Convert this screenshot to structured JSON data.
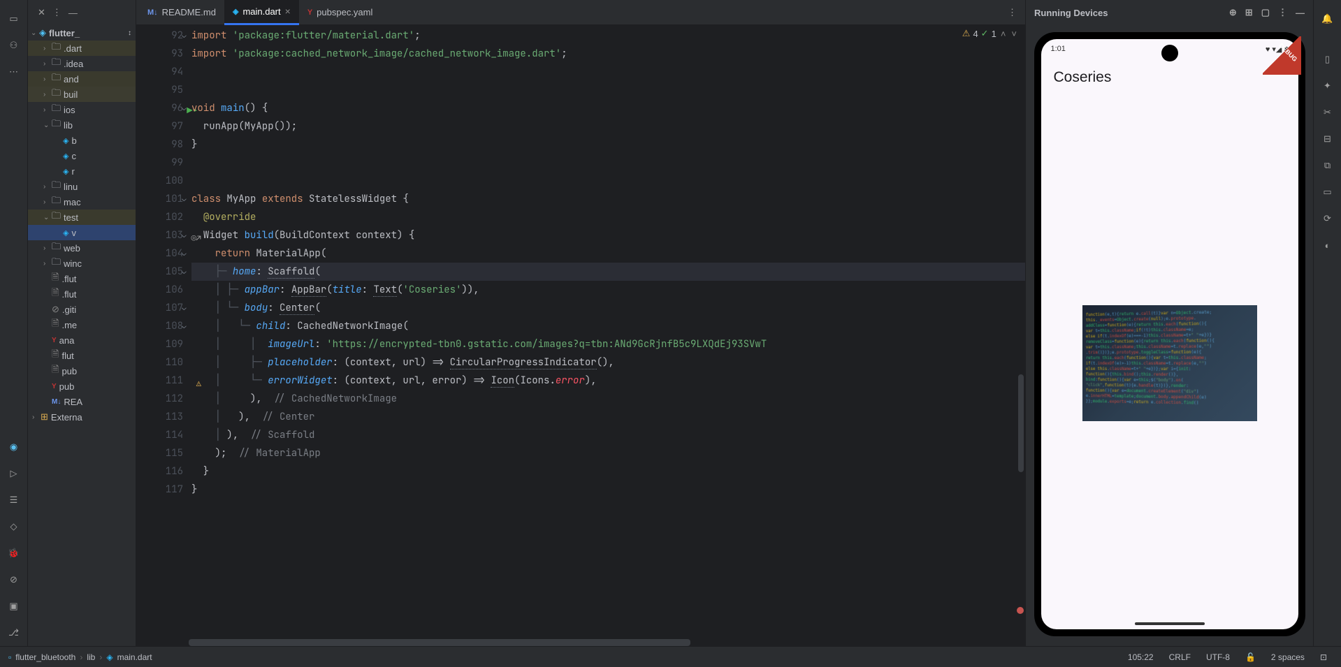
{
  "tabs": [
    {
      "icon": "M↓",
      "iconColor": "#6c95eb",
      "label": "README.md",
      "active": false
    },
    {
      "icon": "◈",
      "iconColor": "#29b6f6",
      "label": "main.dart",
      "active": true,
      "closeable": true
    },
    {
      "icon": "Y",
      "iconColor": "#c23434",
      "label": "pubspec.yaml",
      "active": false
    }
  ],
  "project": {
    "root": "flutter_",
    "items": [
      {
        "indent": 1,
        "chev": "›",
        "folder": true,
        "label": ".dart",
        "hl": true
      },
      {
        "indent": 1,
        "chev": "›",
        "folder": true,
        "label": ".idea"
      },
      {
        "indent": 1,
        "chev": "›",
        "folder": true,
        "label": "and",
        "hl": true
      },
      {
        "indent": 1,
        "chev": "›",
        "folder": true,
        "label": "buil",
        "hl2": true
      },
      {
        "indent": 1,
        "chev": "›",
        "folder": true,
        "label": "ios"
      },
      {
        "indent": 1,
        "chev": "⌄",
        "folder": true,
        "label": "lib"
      },
      {
        "indent": 2,
        "dart": true,
        "label": "b"
      },
      {
        "indent": 2,
        "dart": true,
        "label": "c"
      },
      {
        "indent": 2,
        "dart": true,
        "label": "r"
      },
      {
        "indent": 1,
        "chev": "›",
        "folder": true,
        "label": "linu"
      },
      {
        "indent": 1,
        "chev": "›",
        "folder": true,
        "label": "mac"
      },
      {
        "indent": 1,
        "chev": "⌄",
        "folder": true,
        "label": "test",
        "hl": true
      },
      {
        "indent": 2,
        "dart": true,
        "label": "v",
        "selected": true
      },
      {
        "indent": 1,
        "chev": "›",
        "folder": true,
        "label": "web"
      },
      {
        "indent": 1,
        "chev": "›",
        "folder": true,
        "label": "winc"
      },
      {
        "indent": 1,
        "file": true,
        "label": ".flut"
      },
      {
        "indent": 1,
        "file": true,
        "label": ".flut"
      },
      {
        "indent": 1,
        "file": true,
        "label": ".giti",
        "gitignore": true
      },
      {
        "indent": 1,
        "file": true,
        "label": ".me"
      },
      {
        "indent": 1,
        "yaml": true,
        "label": "ana"
      },
      {
        "indent": 1,
        "file": true,
        "label": "flut"
      },
      {
        "indent": 1,
        "file": true,
        "label": "pub"
      },
      {
        "indent": 1,
        "yaml": true,
        "label": "pub"
      },
      {
        "indent": 1,
        "md": true,
        "label": "REA"
      },
      {
        "indent": 0,
        "chev": "›",
        "lib": true,
        "label": "Externa"
      }
    ]
  },
  "inspections": {
    "warnings": "4",
    "checks": "1"
  },
  "code": {
    "lines": [
      {
        "n": "92",
        "fold": "⌄",
        "html": "<span class='kw'>import</span> <span class='str'>'package:flutter/material.dart'</span>;"
      },
      {
        "n": "93",
        "html": "<span class='kw'>import</span> <span class='str'>'package:cached_network_image/cached_network_image.dart'</span>;"
      },
      {
        "n": "94",
        "html": ""
      },
      {
        "n": "95",
        "html": ""
      },
      {
        "n": "96",
        "run": true,
        "fold": "⌄",
        "html": "<span class='kw'>void</span> <span class='func'>main</span>() {"
      },
      {
        "n": "97",
        "html": "  runApp(MyApp());"
      },
      {
        "n": "98",
        "html": "}"
      },
      {
        "n": "99",
        "html": ""
      },
      {
        "n": "100",
        "html": ""
      },
      {
        "n": "101",
        "fold": "⌄",
        "html": "<span class='kw'>class</span> <span class='type'>MyApp</span> <span class='kw'>extends</span> <span class='type'>StatelessWidget</span> {"
      },
      {
        "n": "102",
        "html": "  <span class='meta'>@override</span>"
      },
      {
        "n": "103",
        "target": true,
        "fold": "⌄",
        "html": "  <span class='type'>Widget</span> <span class='func'>build</span>(<span class='type'>BuildContext</span> context) {"
      },
      {
        "n": "104",
        "fold": "⌄",
        "html": "    <span class='kw'>return</span> MaterialApp("
      },
      {
        "n": "105",
        "fold": "⌄",
        "cursor": true,
        "html": "    <span class='guide'>├─</span> <span class='param'>home</span>: <span class='info'>Scaffold</span>("
      },
      {
        "n": "106",
        "html": "    <span class='guide'>│ ├─</span> <span class='param'>appBar</span>: <span class='info'>AppBar</span>(<span class='param'>title</span>: <span class='info'>Text</span>(<span class='str'>'Coseries'</span>)),"
      },
      {
        "n": "107",
        "fold": "⌄",
        "html": "    <span class='guide'>│ └─</span> <span class='param'>body</span>: <span class='info'>Center</span>("
      },
      {
        "n": "108",
        "fold": "⌄",
        "html": "    <span class='guide'>│   └─</span> <span class='param'>child</span>: CachedNetworkImage("
      },
      {
        "n": "109",
        "html": "    <span class='guide'>│     │ </span> <span class='param'>imageUrl</span>: <span class='str'>'https://encrypted-tbn0.gstatic.com/images?q=tbn:ANd9GcRjnfB5c9LXQdEj93SVwT</span>"
      },
      {
        "n": "110",
        "html": "    <span class='guide'>│     ├─</span> <span class='param'>placeholder</span>: (context, url) => <span class='info'>CircularProgressIndicator</span>(),"
      },
      {
        "n": "111",
        "warn": true,
        "html": "    <span class='guide'>│     └─</span> <span class='param'>errorWidget</span>: (context, url, error) => <span class='info'>Icon</span>(Icons.<span class='error-field'>error</span>),"
      },
      {
        "n": "112",
        "html": "    <span class='guide'>│     </span>),  <span class='comment'>// CachedNetworkImage</span>"
      },
      {
        "n": "113",
        "html": "    <span class='guide'>│   </span>),  <span class='comment'>// Center</span>"
      },
      {
        "n": "114",
        "html": "    <span class='guide'>│ </span>),  <span class='comment'>// Scaffold</span>"
      },
      {
        "n": "115",
        "html": "    );  <span class='comment'>// MaterialApp</span>"
      },
      {
        "n": "116",
        "html": "  }"
      },
      {
        "n": "117",
        "html": "}"
      }
    ]
  },
  "devices": {
    "title": "Running Devices",
    "statusTime": "1:01",
    "signalIcons": "♥ ▾◢ ▮",
    "appTitle": "Coseries"
  },
  "statusBar": {
    "breadcrumbs": [
      "flutter_bluetooth",
      "lib",
      "main.dart"
    ],
    "position": "105:22",
    "lineEnding": "CRLF",
    "encoding": "UTF-8",
    "indent": "2 spaces"
  }
}
